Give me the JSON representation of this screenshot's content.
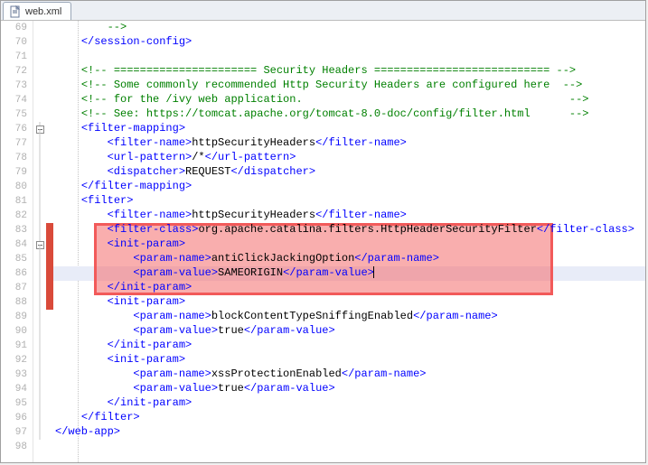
{
  "tab": {
    "label": "web.xml"
  },
  "gutterStart": 69,
  "currentLineIndex": 17,
  "foldMarkers": {
    "7": "minus",
    "15": "minus"
  },
  "changeBar": {
    "from": 14,
    "to": 19
  },
  "lines": [
    [
      [
        "",
        "        "
      ],
      [
        "cm",
        "-->"
      ]
    ],
    [
      [
        "",
        "    "
      ],
      [
        "tg",
        "</session-config>"
      ]
    ],
    [
      [
        "",
        ""
      ]
    ],
    [
      [
        "",
        "    "
      ],
      [
        "cm",
        "<!-- ====================== Security Headers =========================== -->"
      ]
    ],
    [
      [
        "",
        "    "
      ],
      [
        "cm",
        "<!-- Some commonly recommended Http Security Headers are configured here  -->"
      ]
    ],
    [
      [
        "",
        "    "
      ],
      [
        "cm",
        "<!-- for the /ivy web application.                                         -->"
      ]
    ],
    [
      [
        "",
        "    "
      ],
      [
        "cm",
        "<!-- See: https://tomcat.apache.org/tomcat-8.0-doc/config/filter.html      -->"
      ]
    ],
    [
      [
        "",
        "    "
      ],
      [
        "tg",
        "<filter-mapping>"
      ]
    ],
    [
      [
        "",
        "        "
      ],
      [
        "tg",
        "<filter-name>"
      ],
      [
        "tx",
        "httpSecurityHeaders"
      ],
      [
        "tg",
        "</filter-name>"
      ]
    ],
    [
      [
        "",
        "        "
      ],
      [
        "tg",
        "<url-pattern>"
      ],
      [
        "tx",
        "/*"
      ],
      [
        "tg",
        "</url-pattern>"
      ]
    ],
    [
      [
        "",
        "        "
      ],
      [
        "tg",
        "<dispatcher>"
      ],
      [
        "tx",
        "REQUEST"
      ],
      [
        "tg",
        "</dispatcher>"
      ]
    ],
    [
      [
        "",
        "    "
      ],
      [
        "tg",
        "</filter-mapping>"
      ]
    ],
    [
      [
        "",
        "    "
      ],
      [
        "tg",
        "<filter>"
      ]
    ],
    [
      [
        "",
        "        "
      ],
      [
        "tg",
        "<filter-name>"
      ],
      [
        "tx",
        "httpSecurityHeaders"
      ],
      [
        "tg",
        "</filter-name>"
      ]
    ],
    [
      [
        "",
        "        "
      ],
      [
        "tg",
        "<filter-class>"
      ],
      [
        "tx",
        "org.apache.catalina.filters.HttpHeaderSecurityFilter"
      ],
      [
        "tg",
        "</filter-class>"
      ]
    ],
    [
      [
        "",
        "        "
      ],
      [
        "tg",
        "<init-param>"
      ]
    ],
    [
      [
        "",
        "            "
      ],
      [
        "tg",
        "<param-name>"
      ],
      [
        "tx",
        "antiClickJackingOption"
      ],
      [
        "tg",
        "</param-name>"
      ]
    ],
    [
      [
        "",
        "            "
      ],
      [
        "tg",
        "<param-value>"
      ],
      [
        "tx",
        "SAMEORIGIN"
      ],
      [
        "tg",
        "</param-value>"
      ]
    ],
    [
      [
        "",
        "        "
      ],
      [
        "tg",
        "</init-param>"
      ]
    ],
    [
      [
        "",
        "        "
      ],
      [
        "tg",
        "<init-param>"
      ]
    ],
    [
      [
        "",
        "            "
      ],
      [
        "tg",
        "<param-name>"
      ],
      [
        "tx",
        "blockContentTypeSniffingEnabled"
      ],
      [
        "tg",
        "</param-name>"
      ]
    ],
    [
      [
        "",
        "            "
      ],
      [
        "tg",
        "<param-value>"
      ],
      [
        "tx",
        "true"
      ],
      [
        "tg",
        "</param-value>"
      ]
    ],
    [
      [
        "",
        "        "
      ],
      [
        "tg",
        "</init-param>"
      ]
    ],
    [
      [
        "",
        "        "
      ],
      [
        "tg",
        "<init-param>"
      ]
    ],
    [
      [
        "",
        "            "
      ],
      [
        "tg",
        "<param-name>"
      ],
      [
        "tx",
        "xssProtectionEnabled"
      ],
      [
        "tg",
        "</param-name>"
      ]
    ],
    [
      [
        "",
        "            "
      ],
      [
        "tg",
        "<param-value>"
      ],
      [
        "tx",
        "true"
      ],
      [
        "tg",
        "</param-value>"
      ]
    ],
    [
      [
        "",
        "        "
      ],
      [
        "tg",
        "</init-param>"
      ]
    ],
    [
      [
        "",
        "    "
      ],
      [
        "tg",
        "</filter>"
      ]
    ],
    [
      [
        "tg",
        "</web-app>"
      ]
    ],
    [
      [
        "",
        ""
      ]
    ]
  ]
}
